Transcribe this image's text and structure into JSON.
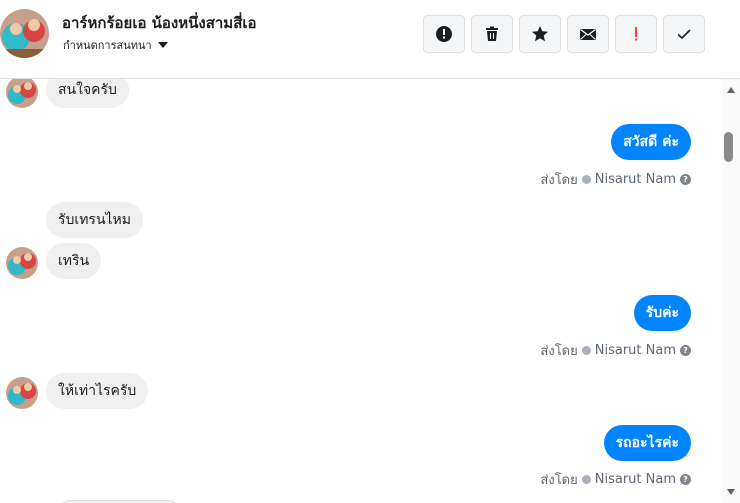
{
  "header": {
    "title": "อาร์หกร้อยเอ น้องหนึ่งสามสี่เอ",
    "subtitle": "กำหนดการสนทนา",
    "toolbar": [
      {
        "name": "report-spam-button",
        "icon": "alert-circle-icon"
      },
      {
        "name": "delete-button",
        "icon": "trash-icon"
      },
      {
        "name": "star-button",
        "icon": "star-icon"
      },
      {
        "name": "mark-unread-button",
        "icon": "envelope-icon"
      },
      {
        "name": "follow-up-button",
        "icon": "exclamation-icon"
      },
      {
        "name": "mark-done-button",
        "icon": "check-icon"
      }
    ]
  },
  "colors": {
    "accent": "#0084ff",
    "incoming_bubble": "#f0f0f0",
    "follow_up": "#fa3e3e"
  },
  "messages": [
    {
      "direction": "in",
      "text": "สนใจครับ"
    },
    {
      "direction": "out",
      "text": "สวัสดี ค่ะ",
      "sent_by_label": "ส่งโดย",
      "sender": "Nisarut Nam"
    },
    {
      "direction": "in",
      "text": "รับเทรนไหม"
    },
    {
      "direction": "in",
      "text": "เทริน"
    },
    {
      "direction": "out",
      "text": "รับค่ะ",
      "sent_by_label": "ส่งโดย",
      "sender": "Nisarut Nam"
    },
    {
      "direction": "in",
      "text": "ให้เท่าไรครับ"
    },
    {
      "direction": "out",
      "text": "รถอะไรค่ะ",
      "sent_by_label": "ส่งโดย",
      "sender": "Nisarut Nam"
    }
  ]
}
